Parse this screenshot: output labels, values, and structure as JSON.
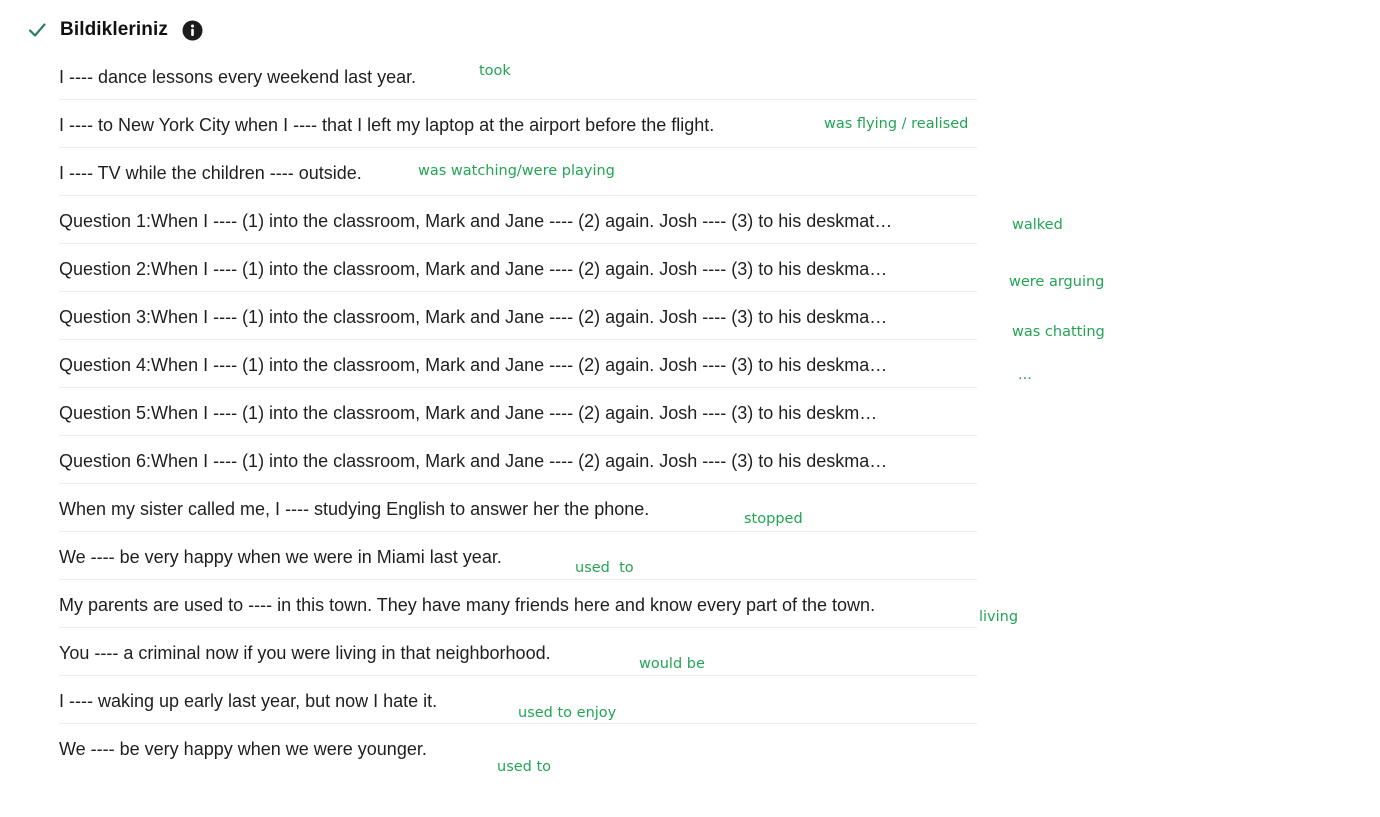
{
  "header": {
    "title": "Bildikleriniz",
    "check_icon": "checkmark-icon",
    "info_icon": "info-icon",
    "accent_color": "#23a455"
  },
  "items": [
    {
      "question": "I ---- dance lessons every weekend last year.",
      "answer": "took"
    },
    {
      "question": "I ---- to New York City when I ---- that I left my laptop at the airport before the flight.",
      "answer": "was flying / realised"
    },
    {
      "question": "I ---- TV while the children ---- outside.",
      "answer": "was watching/were playing"
    },
    {
      "question": "Question 1:When I ---- (1) into the classroom, Mark and Jane ---- (2) again. Josh ---- (3) to his deskmat…",
      "answer": "walked"
    },
    {
      "question": "Question 2:When I ---- (1) into the classroom, Mark and Jane ---- (2) again. Josh ---- (3) to his deskma…",
      "answer": "were arguing"
    },
    {
      "question": "Question 3:When I ---- (1) into the classroom, Mark and Jane ---- (2) again. Josh ---- (3) to his deskma…",
      "answer": "was chatting"
    },
    {
      "question": "Question 4:When I ---- (1) into the classroom, Mark and Jane ---- (2) again. Josh ---- (3) to his deskma…",
      "answer": "..."
    },
    {
      "question": "Question 5:When I ---- (1) into the classroom, Mark and Jane ---- (2) again. Josh ---- (3)  to his deskm…",
      "answer": ""
    },
    {
      "question": "Question 6:When I ---- (1) into the classroom, Mark and Jane ---- (2) again. Josh ---- (3) to his deskma…",
      "answer": ""
    },
    {
      "question": "When my sister called me, I ---- studying English to answer her the phone.",
      "answer": "stopped"
    },
    {
      "question": "We ---- be very happy when we were in Miami last year.",
      "answer": "used  to"
    },
    {
      "question": "My parents are used to ---- in this town. They have many friends here and know every part of the town.",
      "answer": "living"
    },
    {
      "question": "You ---- a criminal now if you were living in that neighborhood.",
      "answer": "would be"
    },
    {
      "question": "I ---- waking up early last year, but now I hate it.",
      "answer": "used to enjoy"
    },
    {
      "question": "We ---- be very happy when we were younger.",
      "answer": "used to"
    }
  ]
}
